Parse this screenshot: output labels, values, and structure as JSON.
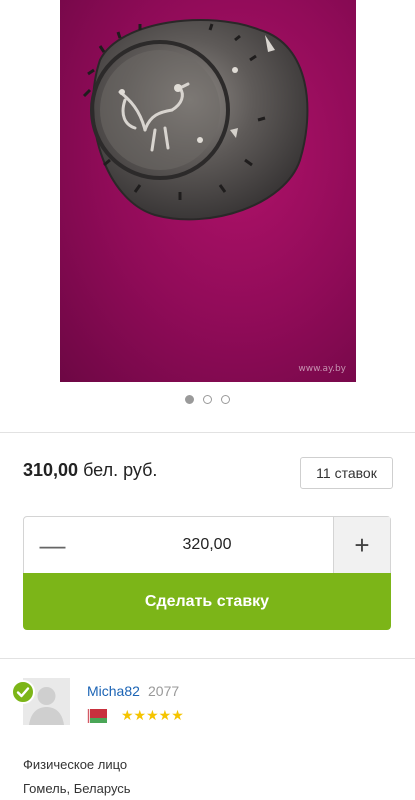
{
  "gallery": {
    "watermark": "www.ay.by",
    "dots": [
      true,
      false,
      false
    ]
  },
  "lot": {
    "price_value": "310,00",
    "price_currency": " бел. руб.",
    "bids_label": "11 ставок"
  },
  "bid": {
    "minus_label": "—",
    "plus_label": "+",
    "amount": "320,00",
    "submit_label": "Сделать ставку"
  },
  "seller": {
    "name": "Micha82",
    "rating": "2077",
    "stars": "★★★★★",
    "type": "Физическое лицо",
    "location": "Гомель, Беларусь"
  },
  "colors": {
    "accent_green": "#7cb518",
    "link_blue": "#1c64b5",
    "star_yellow": "#f5c400",
    "photo_bg": "#9c0d5f"
  }
}
